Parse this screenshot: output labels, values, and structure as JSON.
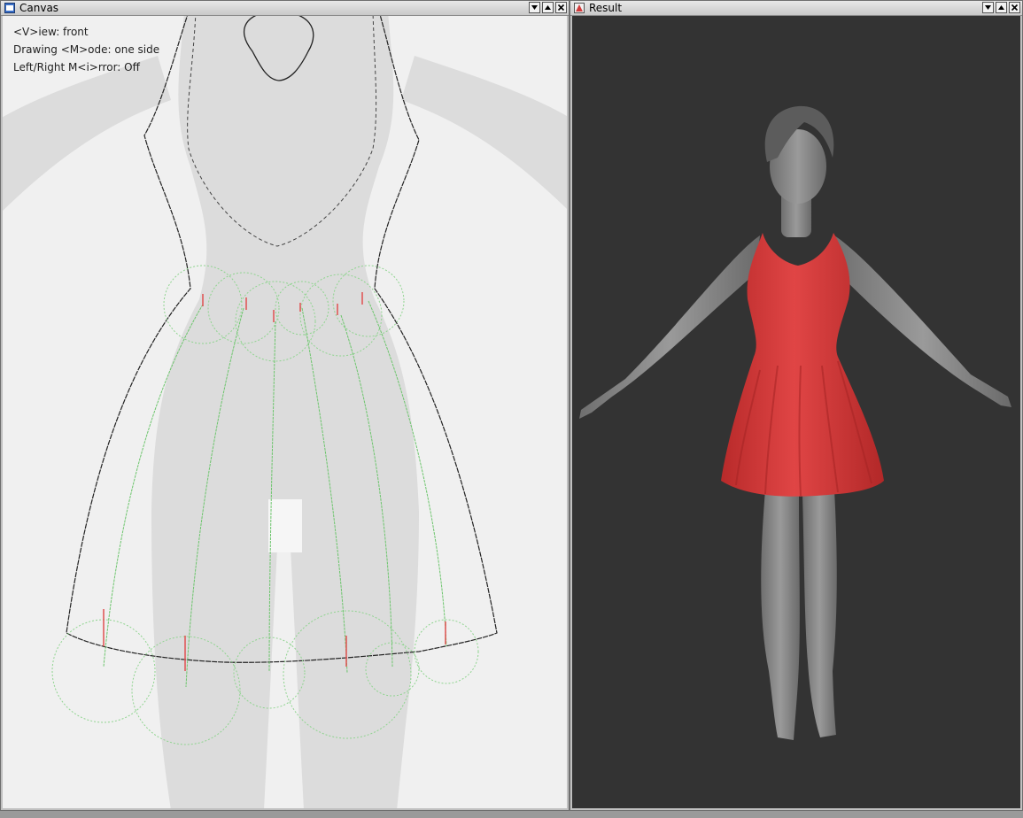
{
  "canvas_window": {
    "title": "Canvas",
    "icon": "canvas-app-icon",
    "controls": [
      "minimize-icon",
      "maximize-icon",
      "close-icon"
    ],
    "hud": {
      "view": "<V>iew: front",
      "drawing_mode": "Drawing <M>ode: one side",
      "mirror": "Left/Right M<i>rror: Off"
    }
  },
  "result_window": {
    "title": "Result",
    "icon": "result-app-icon",
    "controls": [
      "minimize-icon",
      "maximize-icon",
      "close-icon"
    ]
  },
  "colors": {
    "dress": "#d83a3a",
    "mannequin": "#8a8a8a",
    "result_bg": "#333333",
    "canvas_bg": "#f0f0f0",
    "silhouette": "#dcdcdc",
    "outline_stroke": "#222222",
    "green_stroke": "#6cc56c",
    "red_stroke": "#e05050"
  }
}
